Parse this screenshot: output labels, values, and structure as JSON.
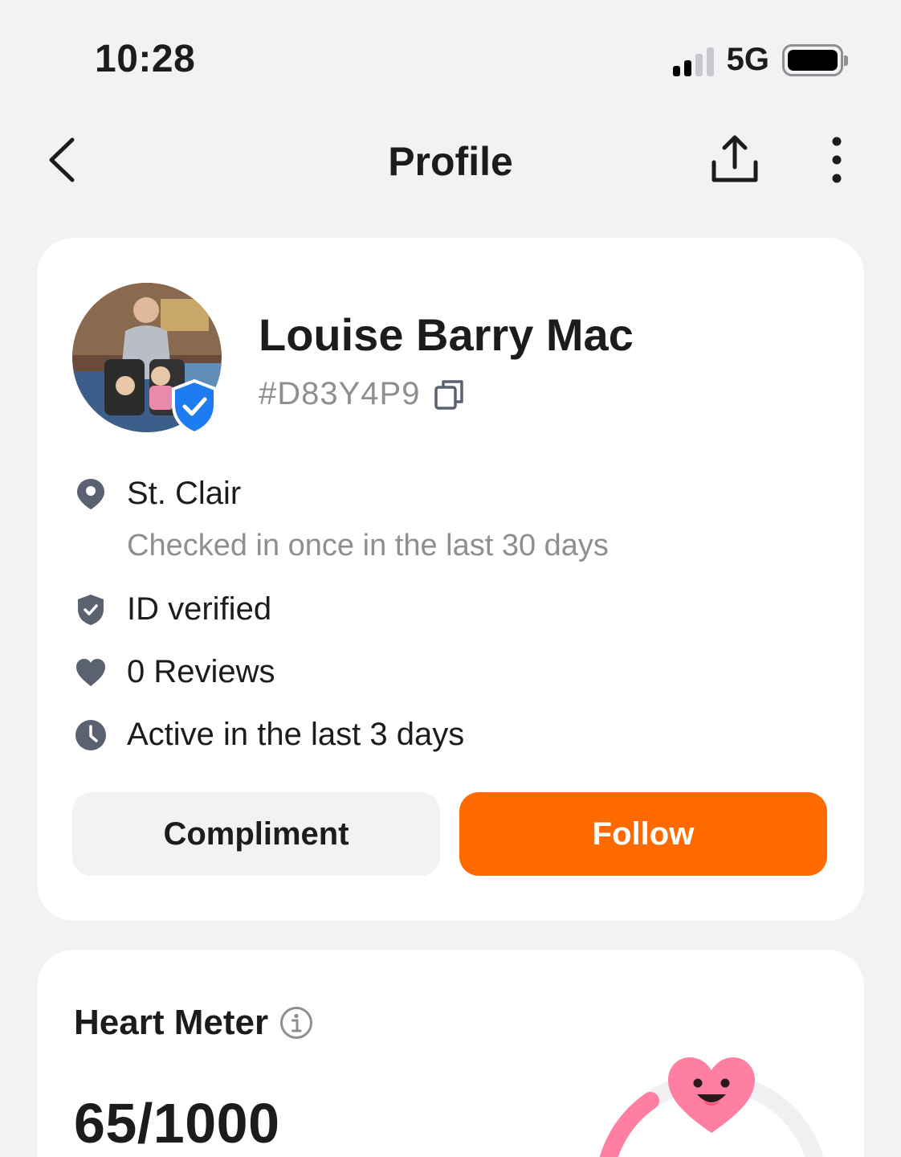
{
  "status_bar": {
    "time": "10:28",
    "network": "5G",
    "signal_bars": 2,
    "battery_level": 1.0
  },
  "nav": {
    "title": "Profile",
    "back_icon": "chevron-left-icon",
    "share_icon": "share-icon",
    "more_icon": "more-vertical-icon"
  },
  "profile": {
    "name": "Louise Barry Mac",
    "user_id": "#D83Y4P9",
    "location": "St. Clair",
    "checkin": "Checked in once in the last 30 days",
    "id_status": "ID verified",
    "reviews": "0 Reviews",
    "activity": "Active in the last 3 days"
  },
  "actions": {
    "compliment_label": "Compliment",
    "follow_label": "Follow"
  },
  "heart_meter": {
    "title": "Heart Meter",
    "score": "65/1000",
    "value": 65,
    "max": 1000
  },
  "colors": {
    "accent": "#ff6a00",
    "verified_blue": "#1e7cf2",
    "meter_pink": "#ff7fa3",
    "icon_gray": "#5a6170"
  }
}
